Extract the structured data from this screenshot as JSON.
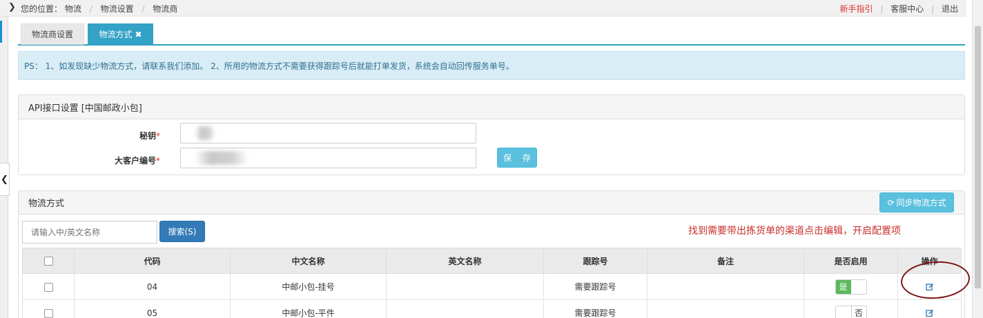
{
  "breadcrumb": {
    "prefix": "您的位置：",
    "items": [
      "物流",
      "物流设置",
      "物流商"
    ]
  },
  "toplinks": {
    "guide": "新手指引",
    "service": "客服中心",
    "logout": "退出"
  },
  "tabs": [
    {
      "label": "物流商设置"
    },
    {
      "label": "物流方式",
      "close": "✖"
    }
  ],
  "notice": "PS： 1、如发现缺少物流方式，请联系我们添加。 2、所用的物流方式不需要获得跟踪号后就能打单发货，系统会自动回传服务单号。",
  "api_panel": {
    "title": "API接口设置  [中国邮政小包]",
    "fields": [
      {
        "label": "秘钥",
        "required_mark": "*",
        "value": ""
      },
      {
        "label": "大客户编号",
        "required_mark": "*",
        "value": ""
      }
    ],
    "save_label": "保 存"
  },
  "shipping_panel": {
    "title": "物流方式",
    "sync_label": "同步物流方式",
    "search_placeholder": "请输入中/英文名称",
    "search_label": "搜索(S)",
    "annotation": "找到需要带出拣货单的渠道点击编辑，开启配置项",
    "columns": [
      "代码",
      "中文名称",
      "英文名称",
      "跟踪号",
      "备注",
      "是否启用",
      "操作"
    ],
    "rows": [
      {
        "code": "04",
        "cn_name": "中邮小包-挂号",
        "en_name": "",
        "tracking": "需要跟踪号",
        "remark": "",
        "enabled": true,
        "toggle_text": "是"
      },
      {
        "code": "05",
        "cn_name": "中邮小包-平件",
        "en_name": "",
        "tracking": "需要跟踪号",
        "remark": "",
        "enabled": false,
        "toggle_text": "否"
      }
    ]
  },
  "colors": {
    "tab_active": "#34a2c6",
    "info_bg": "#d9edf7",
    "info_text": "#31708f",
    "btn_info": "#5bc0de",
    "btn_primary": "#337ab7",
    "toggle_on": "#5cb85c",
    "annotation_red": "#c9302c",
    "annotation_ring": "#7a1416"
  },
  "icons": {
    "sync": "refresh-icon",
    "edit": "edit-icon",
    "breadcrumb_chevron": "chevron-right-icon",
    "sidebar_toggle": "chevron-left-icon"
  }
}
